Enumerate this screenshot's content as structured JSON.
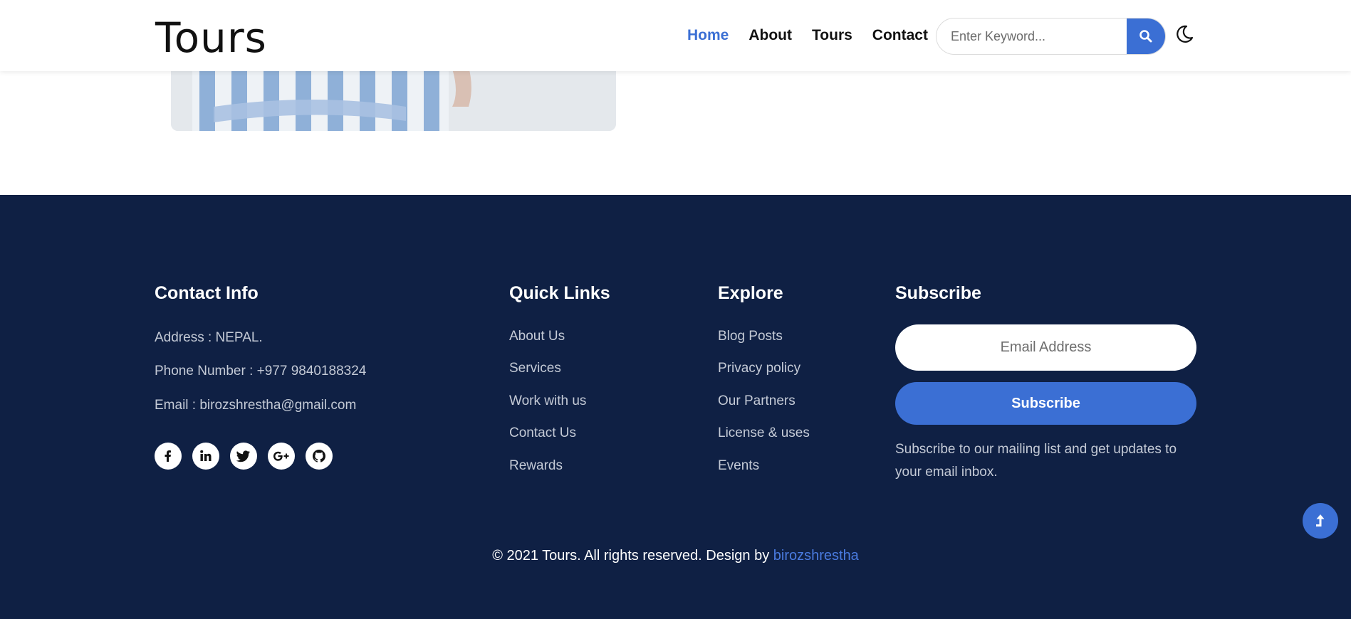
{
  "header": {
    "logo": "Tours",
    "nav": [
      {
        "label": "Home",
        "active": true
      },
      {
        "label": "About",
        "active": false
      },
      {
        "label": "Tours",
        "active": false
      },
      {
        "label": "Contact",
        "active": false
      }
    ],
    "search_placeholder": "Enter Keyword...",
    "search_icon": "search-icon",
    "theme_icon": "moon-icon"
  },
  "footer": {
    "contact": {
      "heading": "Contact Info",
      "address": "Address : NEPAL.",
      "phone": "Phone Number : +977 9840188324",
      "email": "Email : birozshrestha@gmail.com",
      "socials": [
        "facebook-icon",
        "linkedin-icon",
        "twitter-icon",
        "google-plus-icon",
        "github-icon"
      ]
    },
    "quick_links": {
      "heading": "Quick Links",
      "items": [
        "About Us",
        "Services",
        "Work with us",
        "Contact Us",
        "Rewards"
      ]
    },
    "explore": {
      "heading": "Explore",
      "items": [
        "Blog Posts",
        "Privacy policy",
        "Our Partners",
        "License & uses",
        "Events"
      ]
    },
    "subscribe": {
      "heading": "Subscribe",
      "email_placeholder": "Email Address",
      "button_label": "Subscribe",
      "description": "Subscribe to our mailing list and get updates to your email inbox."
    },
    "copyright": {
      "text": "© 2021 Tours. All rights reserved. Design by ",
      "author": "birozshrestha"
    }
  },
  "colors": {
    "accent": "#3b6fd4",
    "footer_bg": "#0f2044"
  }
}
